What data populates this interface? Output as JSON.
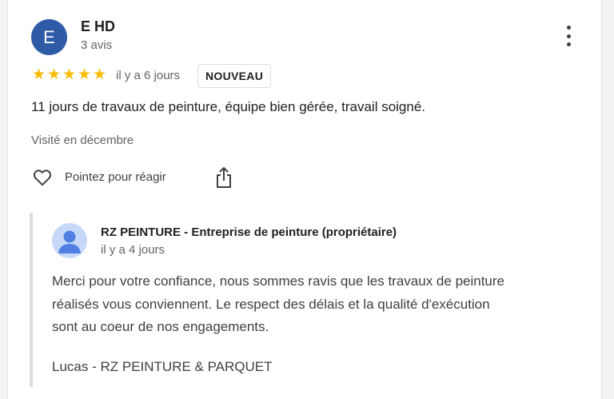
{
  "review": {
    "avatar_initial": "E",
    "reviewer_name": "E HD",
    "reviewer_meta": "3 avis",
    "rating": 5,
    "max_rating": 5,
    "date": "il y a 6 jours",
    "badge": "NOUVEAU",
    "text": "11 jours de travaux de peinture, équipe bien gérée, travail soigné.",
    "visited": "Visité en décembre",
    "react_label": "Pointez pour réagir"
  },
  "owner_reply": {
    "name": "RZ PEINTURE - Entreprise de peinture (propriétaire)",
    "date": "il y a 4 jours",
    "lines": [
      "Merci pour votre confiance, nous sommes ravis que les travaux de peinture",
      "réalisés vous conviennent. Le respect des délais et la qualité d'exécution",
      "sont au coeur de nos engagements."
    ],
    "signature": "Lucas - RZ PEINTURE & PARQUET"
  },
  "colors": {
    "avatar": "#2f5aa6",
    "star": "#fbbc04",
    "owner_avatar": "#c6d8fa",
    "reply_bar": "#dadce0"
  },
  "icons": {
    "more": "more-vert-icon",
    "react": "heart-icon",
    "share": "share-icon",
    "owner_avatar": "person-icon"
  }
}
